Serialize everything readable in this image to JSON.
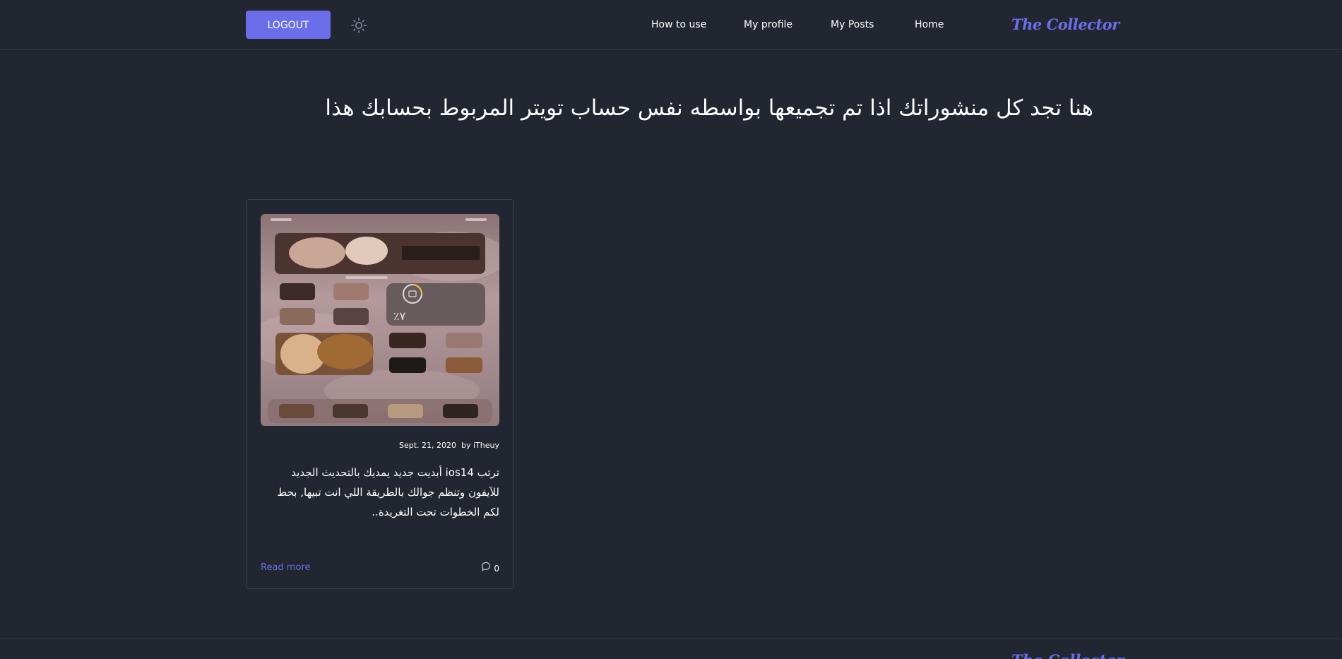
{
  "header": {
    "logout_label": "LOGOUT",
    "theme_icon": "sun-icon",
    "nav": {
      "how_to_use": "How to use",
      "my_profile": "My profile",
      "my_posts": "My Posts",
      "home": "Home"
    },
    "brand": "The Collector"
  },
  "page": {
    "heading": "هنا تجد كل منشوراتك اذا تم تجميعها بواسطه نفس حساب تويتر المربوط بحسابك هذا"
  },
  "posts": [
    {
      "date": "Sept. 21, 2020",
      "author": "by iTheuy",
      "excerpt": "ترتب ios14 أبديت جديد يمديك بالتحديث الجديد للآيفون وتنظم جوالك بالطريقة اللي انت تبيها, بحط لكم الخطوات تحت التغريدة..",
      "read_more": "Read more",
      "comment_count": "0",
      "comment_icon": "comment-bubble-icon",
      "image_alt": "iOS 14 home screen with Renaissance painting themed widgets and icons"
    }
  ],
  "footer": {
    "brand": "The Collector"
  },
  "colors": {
    "background": "#212631",
    "accent": "#6a6ee8",
    "text": "#ffffff",
    "border": "#3a4150"
  }
}
